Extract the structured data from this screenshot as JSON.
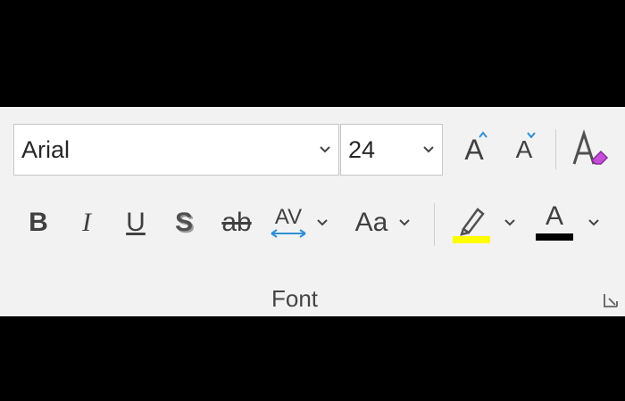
{
  "font_group": {
    "label": "Font",
    "font_name": {
      "value": "Arial"
    },
    "font_size": {
      "value": "24"
    },
    "grow_font_label": "A",
    "shrink_font_label": "A",
    "bold_label": "B",
    "italic_label": "I",
    "underline_label": "U",
    "shadow_label": "S",
    "strikethrough_label": "ab",
    "char_spacing_label": "AV",
    "change_case_label": "Aa",
    "font_color_label": "A"
  },
  "colors": {
    "highlight": "#ffff00",
    "font_color": "#000000",
    "clear_format_accent": "#c44ed6",
    "spacing_arrows": "#2e8fd6",
    "grow_shrink_arrows": "#2e8fd6"
  },
  "icons": {
    "clear_formatting": "clear-formatting-icon",
    "highlighter": "highlighter-icon",
    "dialog_launcher": "dialog-launcher-icon",
    "dropdown": "chevron-down-icon"
  }
}
